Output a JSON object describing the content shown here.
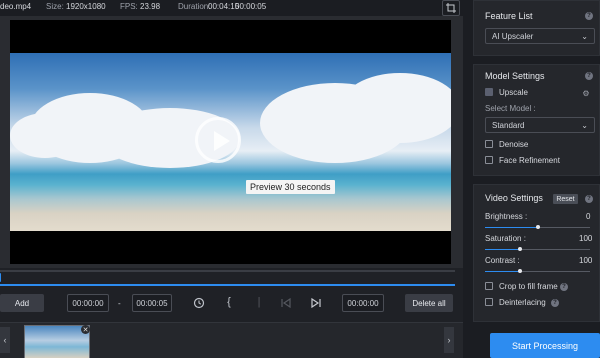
{
  "file_info": {
    "filename": "deo.mp4",
    "size_label": "Size:",
    "size_value": "1920x1080",
    "fps_label": "FPS:",
    "fps_value": "23.98",
    "duration_label": "Duration:",
    "duration_value": "00:04:15",
    "duration_extra": "00:00:05"
  },
  "preview": {
    "tooltip": "Preview 30 seconds"
  },
  "timeline": {
    "progress_fraction": 0.0
  },
  "controls": {
    "add_label": "Add",
    "start_time": "00:00:00",
    "separator": "-",
    "end_time": "00:00:05",
    "position_time": "00:00:00",
    "delete_all_label": "Delete all"
  },
  "icons": {
    "crop": "crop-icon",
    "rewind": "history-icon",
    "mark_in": "bracket-left-icon",
    "step": "step-icon",
    "prev": "skip-back-icon",
    "next": "skip-forward-icon",
    "play": "play-icon",
    "help": "help-icon",
    "close": "close-icon",
    "prev_arrow": "chevron-left-icon",
    "next_arrow": "chevron-right-icon"
  },
  "feature_list": {
    "title": "Feature List",
    "selected": "AI Upscaler"
  },
  "model_settings": {
    "title": "Model Settings",
    "upscale_label": "Upscale",
    "select_model_label": "Select Model :",
    "model_selected": "Standard",
    "denoise_label": "Denoise",
    "face_refinement_label": "Face Refinement"
  },
  "video_settings": {
    "title": "Video Settings",
    "reset_label": "Reset",
    "brightness_label": "Brightness :",
    "brightness_value": "0",
    "brightness_fraction": 0.5,
    "saturation_label": "Saturation :",
    "saturation_value": "100",
    "saturation_fraction": 0.33,
    "contrast_label": "Contrast :",
    "contrast_value": "100",
    "contrast_fraction": 0.33,
    "crop_label": "Crop to fill frame",
    "deinterlacing_label": "Deinterlacing"
  },
  "actions": {
    "start_label": "Start Processing"
  },
  "colors": {
    "accent": "#2d8cf0",
    "background": "#1f2126",
    "panel": "#25272c"
  }
}
